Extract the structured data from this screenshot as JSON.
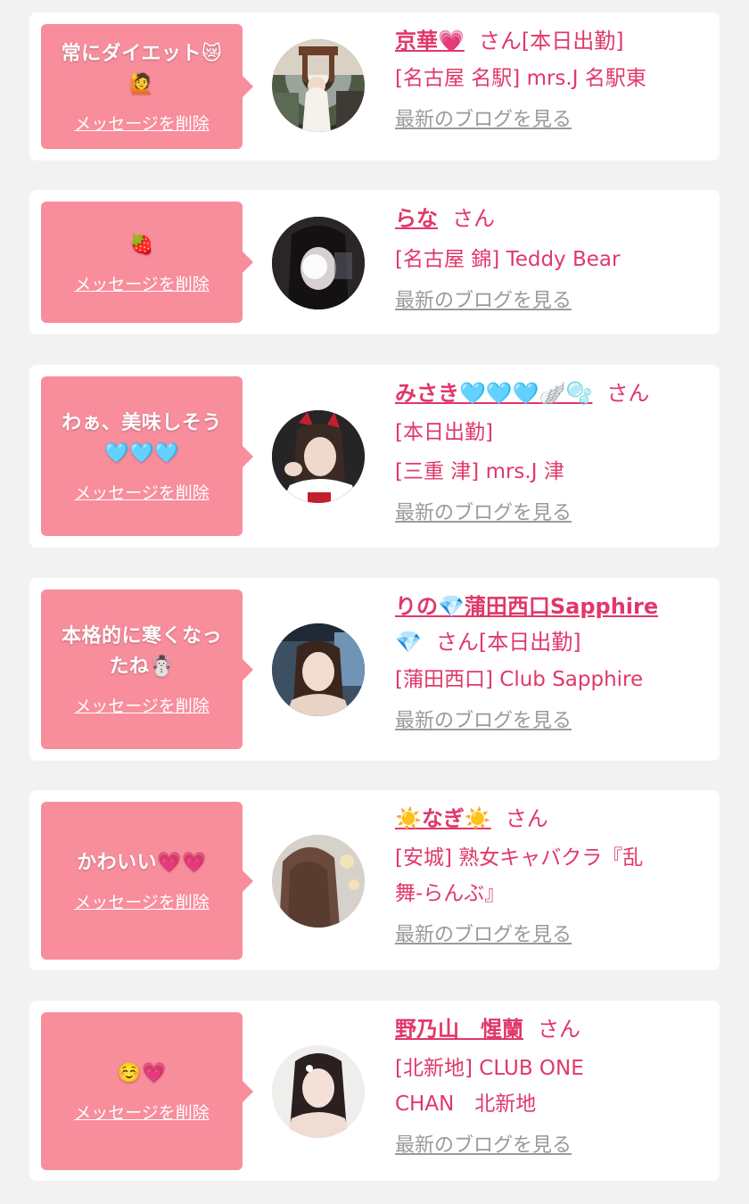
{
  "colors": {
    "accent": "#e0386a",
    "bubble": "#f88d9c",
    "link_gray": "#9a9a9a",
    "background": "#f2f2f2"
  },
  "labels": {
    "delete": "メッセージを削除",
    "blog": "最新のブログを見る",
    "san": "さん"
  },
  "messages": [
    {
      "comment": "常にダイエット😿\n🙋",
      "name": "京華💗",
      "status": "[本日出勤]",
      "shop": "[名古屋 名駅] mrs.J 名駅東",
      "avatar_icon": "avatar-photo"
    },
    {
      "comment": "🍓",
      "name": "らな",
      "status": "",
      "shop": "[名古屋 錦] Teddy Bear",
      "avatar_icon": "avatar-photo"
    },
    {
      "comment": "わぁ、美味しそう\n🩵🩵🩵",
      "name": "みさき🩵🩵🩵🪽🫧",
      "status": "[本日出勤]",
      "shop": "[三重 津] mrs.J 津",
      "avatar_icon": "avatar-photo"
    },
    {
      "comment": "本格的に寒くなっ\nたね☃️",
      "name": "りの💎蒲田西口Sapphire",
      "name_extra": "💎",
      "status": "[本日出勤]",
      "shop": "[蒲田西口] Club Sapphire",
      "avatar_icon": "avatar-photo"
    },
    {
      "comment": "かわいい💗💗",
      "name": "☀️なぎ☀️",
      "status": "",
      "shop": "[安城] 熟女キャバクラ『乱\n舞-らんぶ』",
      "avatar_icon": "avatar-photo"
    },
    {
      "comment": "☺️💗",
      "name": "野乃山　惺蘭",
      "status": "",
      "shop": "[北新地] CLUB ONE\nCHAN　北新地",
      "avatar_icon": "avatar-photo"
    }
  ]
}
